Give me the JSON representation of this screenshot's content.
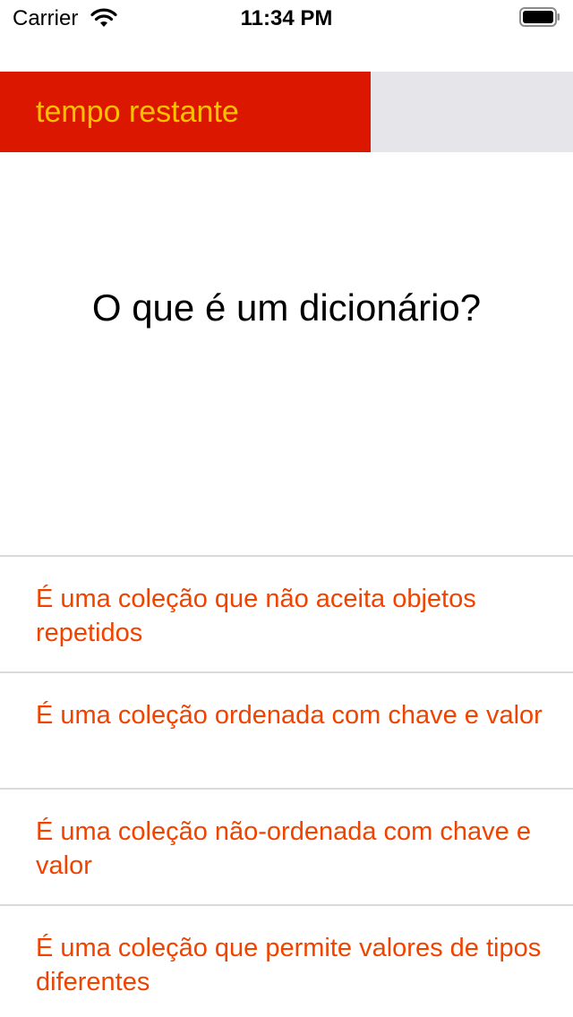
{
  "status_bar": {
    "carrier": "Carrier",
    "time": "11:34 PM",
    "wifi_icon": "wifi-icon",
    "battery_icon": "battery-icon"
  },
  "timer": {
    "label": "tempo restante",
    "remaining_fraction": 0.647,
    "fill_color": "#dc1700",
    "track_color": "#e5e5ea",
    "label_color": "#ffc000"
  },
  "question": {
    "text": "O que é um dicionário?"
  },
  "answers": [
    {
      "text": "É uma coleção que não aceita objetos repetidos"
    },
    {
      "text": "É uma coleção ordenada com chave e valor"
    },
    {
      "text": "É uma coleção não-ordenada com chave e valor"
    },
    {
      "text": "É uma coleção que permite valores de tipos diferentes"
    }
  ],
  "colors": {
    "answer_text": "#f04300",
    "separator": "#d9d9de"
  }
}
